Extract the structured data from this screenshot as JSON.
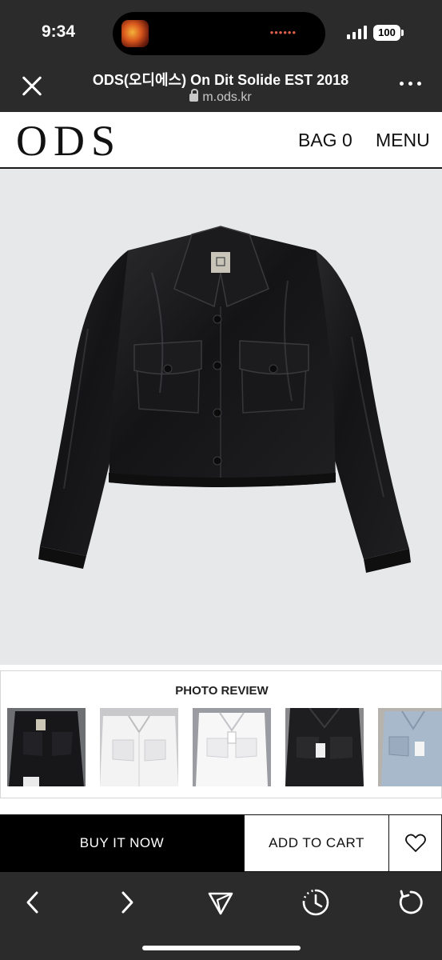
{
  "status_bar": {
    "time": "9:34",
    "battery": "100"
  },
  "browser": {
    "title": "ODS(오디에스) On Dit Solide EST 2018",
    "url": "m.ods.kr"
  },
  "site_header": {
    "logo": "ODS",
    "bag": "BAG 0",
    "menu": "MENU"
  },
  "product": {
    "image": "black-leather-jacket",
    "background_color": "#e7e8ea"
  },
  "photo_review": {
    "title": "PHOTO REVIEW",
    "thumbnails": [
      "black-jacket-photo",
      "white-jacket-photo",
      "white-jacket-photo",
      "black-jacket-photo",
      "light-blue-jacket-photo"
    ]
  },
  "actions": {
    "buy_now": "BUY IT NOW",
    "add_to_cart": "ADD TO CART",
    "wishlist_icon": "heart-icon"
  },
  "toolbar": {
    "icons": [
      "chevron-left-icon",
      "chevron-right-icon",
      "share-icon",
      "history-icon",
      "reload-icon"
    ]
  }
}
